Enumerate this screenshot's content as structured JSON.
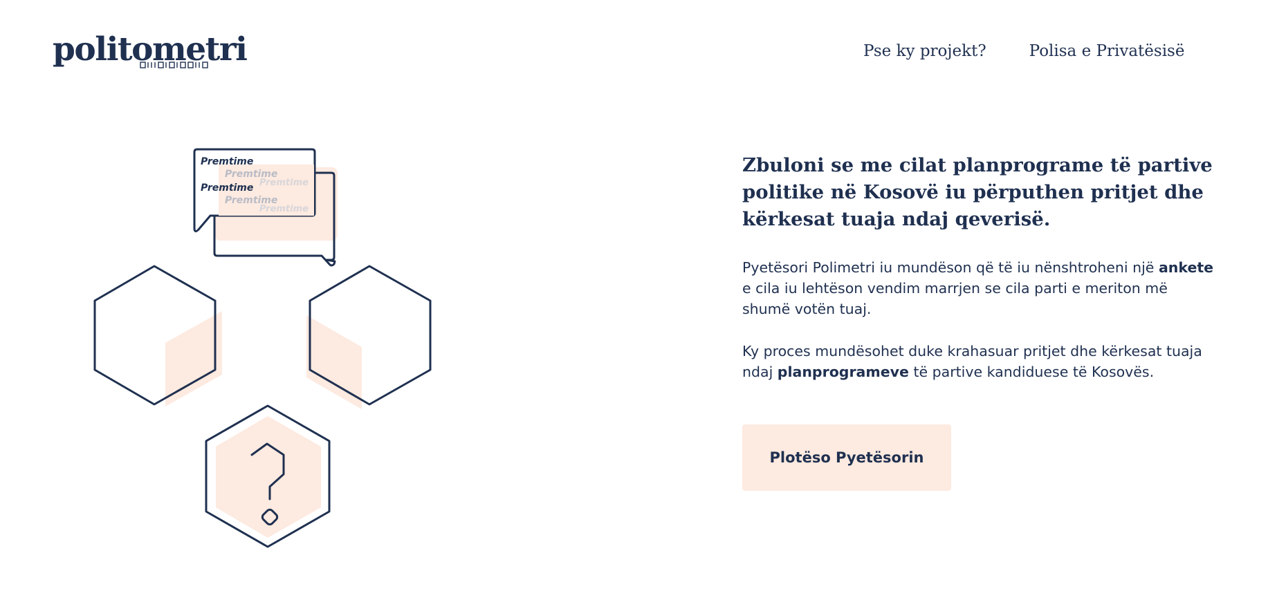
{
  "brand": {
    "name": "politometri",
    "tagline_binary": "0111010100110"
  },
  "nav": {
    "items": [
      {
        "label": "Pse ky projekt?"
      },
      {
        "label": "Polisa e Privatësisë"
      }
    ]
  },
  "illustration": {
    "bubble_label": "Premtime"
  },
  "hero": {
    "headline": "Zbuloni se me cilat planprograme të partive politike në Kosovë iu përputhen pritjet dhe kërkesat tuaja ndaj qeverisë.",
    "paragraph1": {
      "before": "Pyetësori Polimetri iu mundëson që të iu nënshtroheni një ",
      "bold": "ankete",
      "after": " e cila iu lehtëson vendim marrjen se cila parti e meriton më shumë votën tuaj."
    },
    "paragraph2": {
      "before": "Ky proces mundësohet duke krahasuar pritjet dhe kërkesat tuaja ndaj ",
      "bold": "planprogrameve",
      "after": " të partive kandiduese të Kosovës."
    },
    "cta_label": "Plotëso Pyetësorin"
  },
  "colors": {
    "navy": "#1f3050",
    "peach": "#fdeae0"
  }
}
